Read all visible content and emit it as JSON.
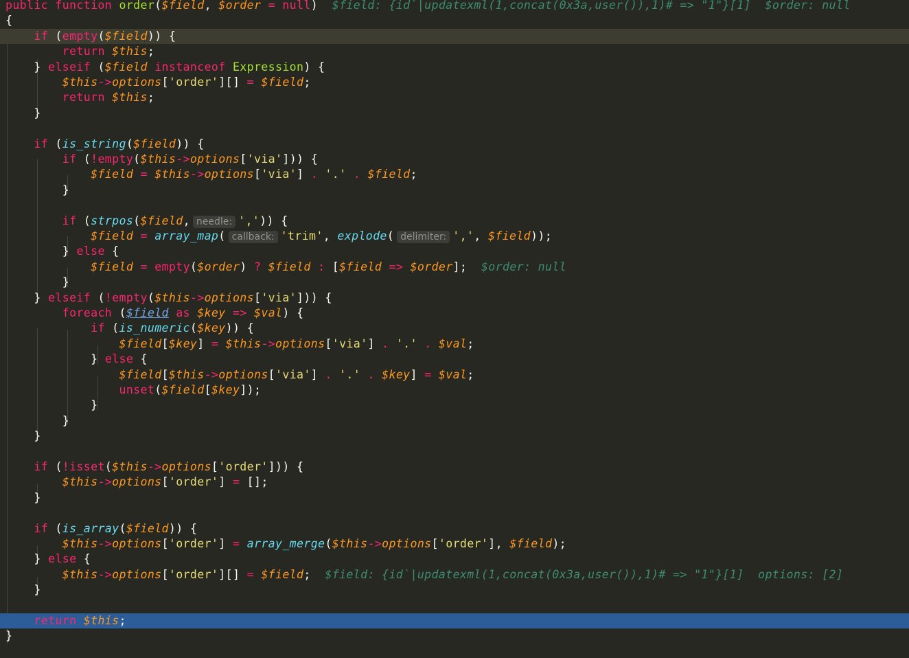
{
  "editor": {
    "lines": [
      {
        "text": "public function order($field, $order = null)  $field: {id`|updatexml(1,concat(0x3a,user()),1)# => \"1\"}[1]  $order: null"
      },
      {
        "text": "{"
      },
      {
        "text": "    if (empty($field)) {"
      },
      {
        "text": "        return $this;"
      },
      {
        "text": "    } elseif ($field instanceof Expression) {"
      },
      {
        "text": "        $this->options['order'][] = $field;"
      },
      {
        "text": "        return $this;"
      },
      {
        "text": "    }"
      },
      {
        "text": ""
      },
      {
        "text": "    if (is_string($field)) {"
      },
      {
        "text": "        if (!empty($this->options['via'])) {"
      },
      {
        "text": "            $field = $this->options['via'] . '.' . $field;"
      },
      {
        "text": "        }"
      },
      {
        "text": ""
      },
      {
        "text": "        if (strpos($field, needle: ',')) {"
      },
      {
        "text": "            $field = array_map( callback: 'trim', explode( delimiter: ',', $field));"
      },
      {
        "text": "        } else {"
      },
      {
        "text": "            $field = empty($order) ? $field : [$field => $order];  $order: null"
      },
      {
        "text": "        }"
      },
      {
        "text": "    } elseif (!empty($this->options['via'])) {"
      },
      {
        "text": "        foreach ($field as $key => $val) {"
      },
      {
        "text": "            if (is_numeric($key)) {"
      },
      {
        "text": "                $field[$key] = $this->options['via'] . '.' . $val;"
      },
      {
        "text": "            } else {"
      },
      {
        "text": "                $field[$this->options['via'] . '.' . $key] = $val;"
      },
      {
        "text": "                unset($field[$key]);"
      },
      {
        "text": "            }"
      },
      {
        "text": "        }"
      },
      {
        "text": "    }"
      },
      {
        "text": ""
      },
      {
        "text": "    if (!isset($this->options['order'])) {"
      },
      {
        "text": "        $this->options['order'] = [];"
      },
      {
        "text": "    }"
      },
      {
        "text": ""
      },
      {
        "text": "    if (is_array($field)) {"
      },
      {
        "text": "        $this->options['order'] = array_merge($this->options['order'], $field);"
      },
      {
        "text": "    } else {"
      },
      {
        "text": "        $this->options['order'][] = $field;  $field: {id`|updatexml(1,concat(0x3a,user()),1)# => \"1\"}[1]  options: [2]"
      },
      {
        "text": "    }"
      },
      {
        "text": ""
      },
      {
        "text": "    return $this;"
      },
      {
        "text": "}"
      }
    ],
    "inlay_hints": {
      "needle": "needle:",
      "callback": "callback:",
      "delimiter": "delimiter:"
    },
    "debug_values": {
      "line1_field": "$field: {id`|updatexml(1,concat(0x3a,user()),1)# => \"1\"}[1]",
      "line1_order": "$order: null",
      "line18_order": "$order: null",
      "line38_field": "$field: {id`|updatexml(1,concat(0x3a,user()),1)# => \"1\"}[1]",
      "line38_options": "options: [2]"
    },
    "current_line": 3,
    "execution_line": 41,
    "colors": {
      "background": "#272822",
      "current_line": "#3e3d32",
      "execution_line": "#2d5d99",
      "keyword": "#f92672",
      "function": "#a6e22e",
      "variable": "#fd971f",
      "builtin": "#66d9ef",
      "string": "#e6db74",
      "debug_hint": "#3d8b73"
    }
  }
}
